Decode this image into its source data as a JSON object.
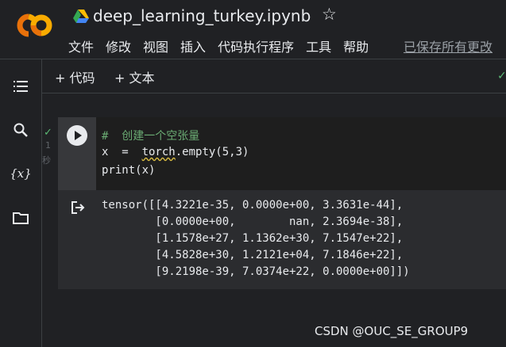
{
  "app": {
    "title": "deep_learning_turkey.ipynb",
    "star_icon": "star-outline-icon",
    "logo_icon": "colab-logo",
    "drive_icon": "google-drive-icon"
  },
  "menu": {
    "items": [
      "文件",
      "修改",
      "视图",
      "插入",
      "代码执行程序",
      "工具",
      "帮助"
    ],
    "saved_status": "已保存所有更改"
  },
  "toolbar": {
    "add_code": "+ 代码",
    "add_text": "+ 文本",
    "connection_icon": "check-icon"
  },
  "sidebar": {
    "icons": [
      "table-of-contents-icon",
      "search-icon",
      "variables-icon",
      "files-icon"
    ]
  },
  "cell": {
    "status_icon": "check-icon",
    "exec_time": "1",
    "exec_unit": "秒",
    "code_lines": [
      "#  创建一个空张量",
      "x  =  torch.empty(5,3)",
      "print(x)"
    ],
    "code_line2_parts": [
      "x  =  ",
      "torch",
      ".empty(5,3)"
    ]
  },
  "output": {
    "icon": "output-redirect-icon",
    "lines": [
      "tensor([[4.3221e-35, 0.0000e+00, 3.3631e-44],",
      "        [0.0000e+00,        nan, 2.3694e-38],",
      "        [1.1578e+27, 1.1362e+30, 7.1547e+22],",
      "        [4.5828e+30, 1.2121e+04, 7.1846e+22],",
      "        [9.2198e-39, 7.0374e+22, 0.0000e+00]])"
    ]
  },
  "watermark": "CSDN @OUC_SE_GROUP9",
  "colors": {
    "accent_orange": "#f9ab00",
    "logo_orange": "#e8710a",
    "ok_green": "#5bb974",
    "comment_green": "#6aab73"
  }
}
